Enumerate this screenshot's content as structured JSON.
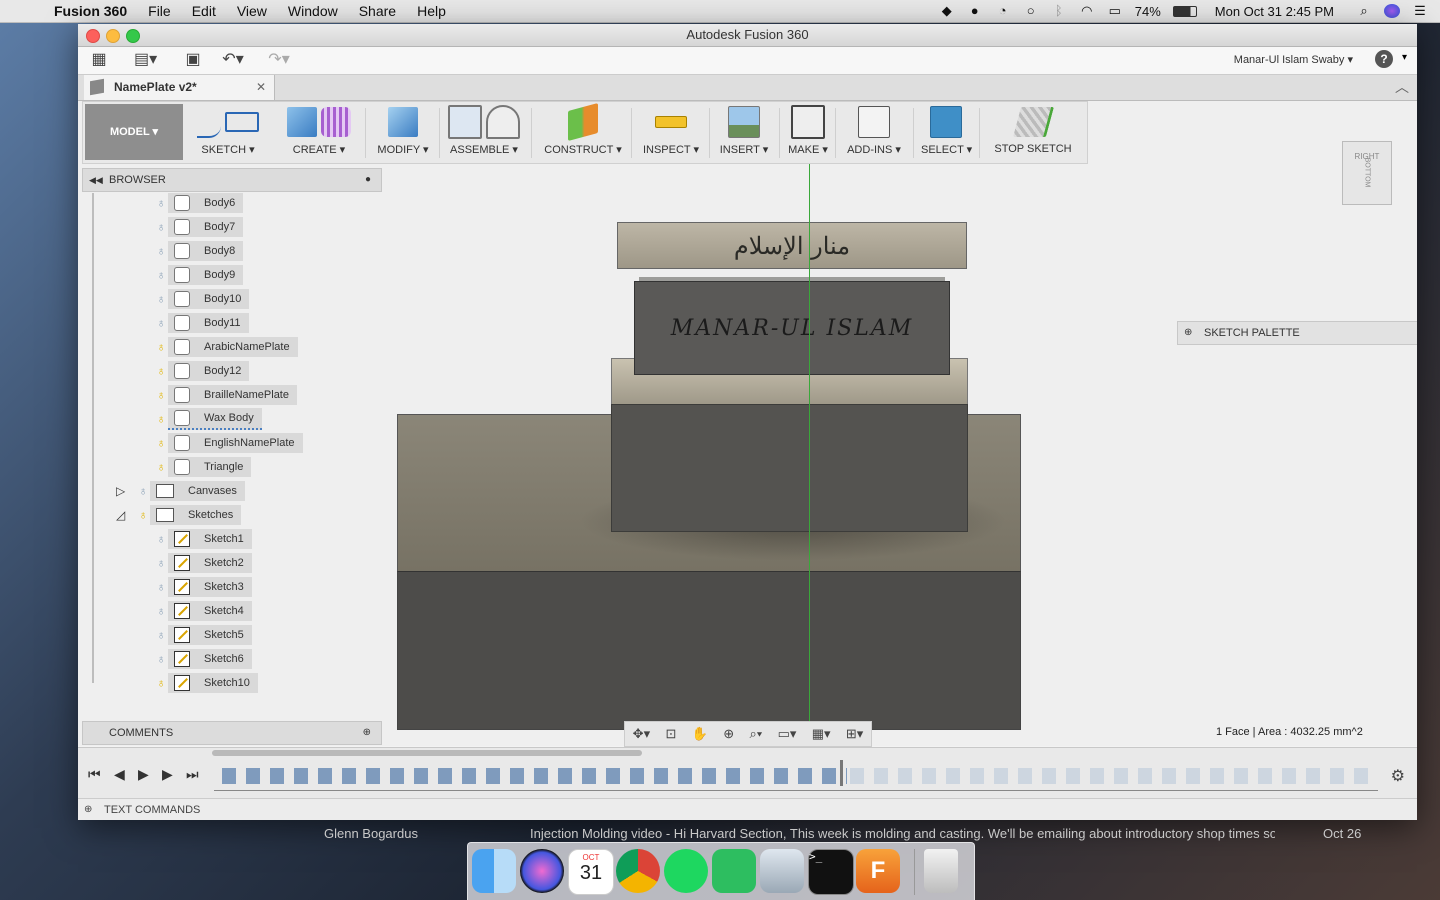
{
  "menubar": {
    "app_name": "Fusion 360",
    "items": [
      "File",
      "Edit",
      "View",
      "Window",
      "Share",
      "Help"
    ],
    "battery": "74%",
    "clock": "Mon Oct 31  2:45 PM"
  },
  "window": {
    "title": "Autodesk Fusion 360",
    "user_name": "Manar-Ul Islam Swaby ▾",
    "help_label": "?",
    "document_tab": "NamePlate v2*"
  },
  "ribbon": {
    "workspace": "MODEL ▾",
    "groups": [
      "SKETCH ▾",
      "CREATE ▾",
      "MODIFY ▾",
      "ASSEMBLE ▾",
      "CONSTRUCT ▾",
      "INSPECT ▾",
      "INSERT ▾",
      "MAKE ▾",
      "ADD-INS ▾",
      "SELECT ▾",
      "STOP SKETCH"
    ]
  },
  "browser": {
    "title": "BROWSER",
    "bodies": [
      "Body6",
      "Body7",
      "Body8",
      "Body9",
      "Body10",
      "Body11",
      "ArabicNamePlate",
      "Body12",
      "BrailleNamePlate",
      "Wax Body",
      "EnglishNamePlate",
      "Triangle"
    ],
    "folders": [
      "Canvases",
      "Sketches"
    ],
    "sketches": [
      "Sketch1",
      "Sketch2",
      "Sketch3",
      "Sketch4",
      "Sketch5",
      "Sketch6",
      "Sketch10"
    ]
  },
  "viewcube": {
    "right": "RIGHT",
    "bottom": "BOTTOM"
  },
  "sketch_palette": "SKETCH PALETTE",
  "comments": "COMMENTS",
  "status": "1 Face | Area : 4032.25 mm^2",
  "text_commands": "TEXT COMMANDS",
  "model_text": {
    "english": "MANAR-UL ISLAM",
    "arabic": "منار الإسلام"
  },
  "background_notification": {
    "sender": "Glenn Bogardus",
    "message": "Injection Molding video - Hi Harvard Section, This week is molding and casting. We'll be emailing about introductory shop times soo",
    "date": "Oct 26"
  },
  "dock": {
    "calendar_month": "OCT",
    "calendar_day": "31"
  },
  "colors": {
    "accent_select": "#3f8fc7",
    "axis_green": "#3aa83a",
    "model_dark": "#4f4e4c",
    "model_light": "#7c7769"
  }
}
